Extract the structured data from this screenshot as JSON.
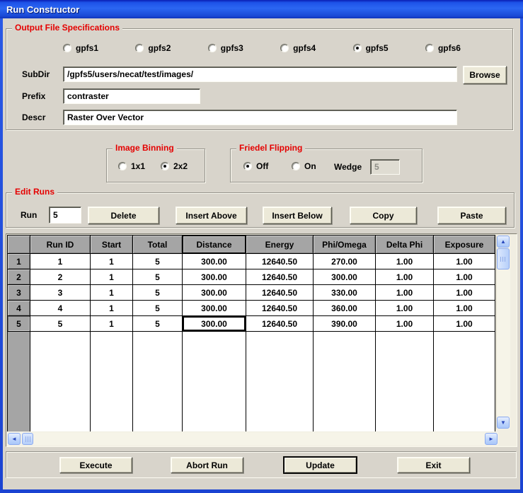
{
  "window": {
    "title": "Run Constructor"
  },
  "output_file_specifications": {
    "label": "Output File Specifications",
    "filesystems": [
      {
        "label": "gpfs1",
        "selected": false
      },
      {
        "label": "gpfs2",
        "selected": false
      },
      {
        "label": "gpfs3",
        "selected": false
      },
      {
        "label": "gpfs4",
        "selected": false
      },
      {
        "label": "gpfs5",
        "selected": true
      },
      {
        "label": "gpfs6",
        "selected": false
      }
    ],
    "subdir": {
      "label": "SubDir",
      "value": "/gpfs5/users/necat/test/images/"
    },
    "browse_label": "Browse",
    "prefix": {
      "label": "Prefix",
      "value": "contraster"
    },
    "descr": {
      "label": "Descr",
      "value": "Raster Over Vector"
    }
  },
  "image_binning": {
    "label": "Image Binning",
    "options": [
      {
        "label": "1x1",
        "selected": false
      },
      {
        "label": "2x2",
        "selected": true
      }
    ]
  },
  "friedel_flipping": {
    "label": "Friedel Flipping",
    "off_label": "Off",
    "on_label": "On",
    "off_selected": true,
    "wedge": {
      "label": "Wedge",
      "value": "5",
      "disabled": true
    }
  },
  "edit_runs": {
    "label": "Edit Runs",
    "run_label": "Run",
    "run_value": "5",
    "buttons": [
      "Delete",
      "Insert Above",
      "Insert Below",
      "Copy",
      "Paste"
    ]
  },
  "table": {
    "columns": [
      "Run ID",
      "Start",
      "Total",
      "Distance",
      "Energy",
      "Phi/Omega",
      "Delta Phi",
      "Exposure"
    ],
    "selected_column": "Distance",
    "selected_cell": {
      "row": 5,
      "column": "Distance"
    },
    "rows": [
      [
        "1",
        "1",
        "1",
        "5",
        "300.00",
        "12640.50",
        "270.00",
        "1.00",
        "1.00"
      ],
      [
        "2",
        "2",
        "1",
        "5",
        "300.00",
        "12640.50",
        "300.00",
        "1.00",
        "1.00"
      ],
      [
        "3",
        "3",
        "1",
        "5",
        "300.00",
        "12640.50",
        "330.00",
        "1.00",
        "1.00"
      ],
      [
        "4",
        "4",
        "1",
        "5",
        "300.00",
        "12640.50",
        "360.00",
        "1.00",
        "1.00"
      ],
      [
        "5",
        "5",
        "1",
        "5",
        "300.00",
        "12640.50",
        "390.00",
        "1.00",
        "1.00"
      ]
    ]
  },
  "footer_buttons": [
    "Execute",
    "Abort Run",
    "Update",
    "Exit"
  ],
  "colors": {
    "titlebar_blue": "#1d53e8",
    "dialog_bg": "#d8d4cb",
    "group_label_red": "#e50000",
    "table_header_gray": "#a5a5a5",
    "button_face": "#ece9d8"
  }
}
